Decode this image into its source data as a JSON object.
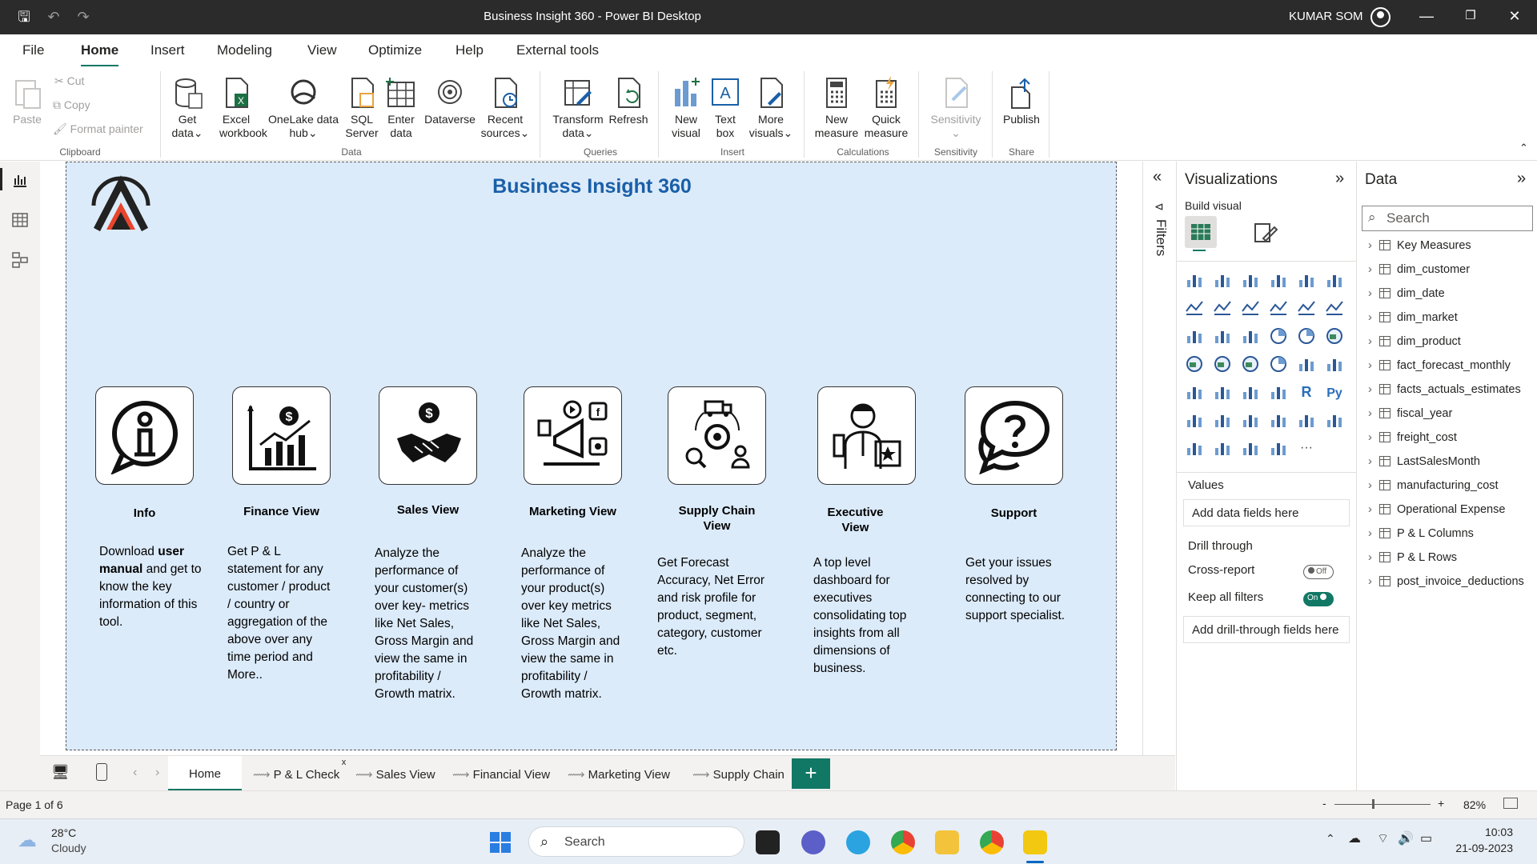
{
  "window": {
    "title": "Business Insight 360 - Power BI Desktop",
    "user": "KUMAR SOM"
  },
  "menu": [
    "File",
    "Home",
    "Insert",
    "Modeling",
    "View",
    "Optimize",
    "Help",
    "External tools"
  ],
  "ribbon": {
    "clipboard": {
      "paste": "Paste",
      "cut": "Cut",
      "copy": "Copy",
      "format_painter": "Format painter",
      "label": "Clipboard"
    },
    "data": {
      "get_data": [
        "Get",
        "data"
      ],
      "excel": [
        "Excel",
        "workbook"
      ],
      "onelake": [
        "OneLake data",
        "hub"
      ],
      "sql": [
        "SQL",
        "Server"
      ],
      "enter": [
        "Enter",
        "data"
      ],
      "dataverse": "Dataverse",
      "recent": [
        "Recent",
        "sources"
      ],
      "label": "Data"
    },
    "queries": {
      "transform": [
        "Transform",
        "data"
      ],
      "refresh": "Refresh",
      "label": "Queries"
    },
    "insert": {
      "new_visual": [
        "New",
        "visual"
      ],
      "text_box": [
        "Text",
        "box"
      ],
      "more_visuals": [
        "More",
        "visuals"
      ],
      "label": "Insert"
    },
    "calculations": {
      "new_measure": [
        "New",
        "measure"
      ],
      "quick_measure": [
        "Quick",
        "measure"
      ],
      "label": "Calculations"
    },
    "sensitivity": {
      "btn": "Sensitivity",
      "label": "Sensitivity"
    },
    "share": {
      "publish": "Publish",
      "label": "Share"
    }
  },
  "report": {
    "title": "Business Insight 360",
    "cards": [
      {
        "title": [
          "Info"
        ],
        "desc": [
          "Download <b>user</b>",
          "<b>manual</b> and get to",
          "know the key",
          "information of this",
          "tool."
        ]
      },
      {
        "title": [
          "Finance View"
        ],
        "desc": [
          "Get  P & L",
          "statement for any",
          "customer / product",
          "/ country or",
          "aggregation of the",
          "above over any",
          "time period and",
          "More.."
        ]
      },
      {
        "title": [
          "Sales View"
        ],
        "desc": [
          "Analyze the",
          "performance of",
          "your customer(s)",
          "over key- metrics",
          "like Net Sales,",
          "Gross Margin and",
          "view the same in",
          "profitability /",
          "Growth matrix."
        ]
      },
      {
        "title": [
          "Marketing View"
        ],
        "desc": [
          "Analyze the",
          "performance of",
          "your product(s)",
          "over key metrics",
          "like Net Sales,",
          "Gross Margin and",
          "view the same in",
          "profitability /",
          "Growth matrix."
        ]
      },
      {
        "title": [
          "Supply Chain",
          "View"
        ],
        "desc": [
          "Get Forecast",
          "Accuracy, Net Error",
          "and risk profile for",
          "product, segment,",
          "category, customer",
          "etc."
        ]
      },
      {
        "title": [
          "Executive",
          "View"
        ],
        "desc": [
          "A top level",
          "dashboard for",
          "executives",
          "consolidating top",
          "insights from all",
          "dimensions of",
          "business."
        ]
      },
      {
        "title": [
          "Support"
        ],
        "desc": [
          "Get your issues",
          "resolved by",
          "connecting to our",
          "support specialist."
        ]
      }
    ]
  },
  "page_tabs": [
    "Home",
    "P & L Check",
    "Sales View",
    "Financial View",
    "Marketing View",
    "Supply Chain"
  ],
  "filters_label": "Filters",
  "visualizations": {
    "title": "Visualizations",
    "build_visual": "Build visual",
    "values": "Values",
    "add_data_fields": "Add data fields here",
    "drill_through": "Drill through",
    "cross_report": "Cross-report",
    "cross_report_state": "Off",
    "keep_all_filters": "Keep all filters",
    "keep_all_filters_state": "On",
    "add_drill_fields": "Add drill-through fields here"
  },
  "data_pane": {
    "title": "Data",
    "search_placeholder": "Search",
    "items": [
      "Key Measures",
      "dim_customer",
      "dim_date",
      "dim_market",
      "dim_product",
      "fact_forecast_monthly",
      "facts_actuals_estimates",
      "fiscal_year",
      "freight_cost",
      "LastSalesMonth",
      "manufacturing_cost",
      "Operational Expense",
      "P & L Columns",
      "P & L Rows",
      "post_invoice_deductions"
    ]
  },
  "status": {
    "page": "Page 1 of 6",
    "zoom": "82%"
  },
  "taskbar": {
    "temp": "28°C",
    "weather": "Cloudy",
    "search": "Search",
    "time": "10:03",
    "date": "21-09-2023"
  },
  "colors": {
    "accent": "#117865",
    "title_blue": "#1a5fa8",
    "canvas_bg": "#dcebfa"
  }
}
